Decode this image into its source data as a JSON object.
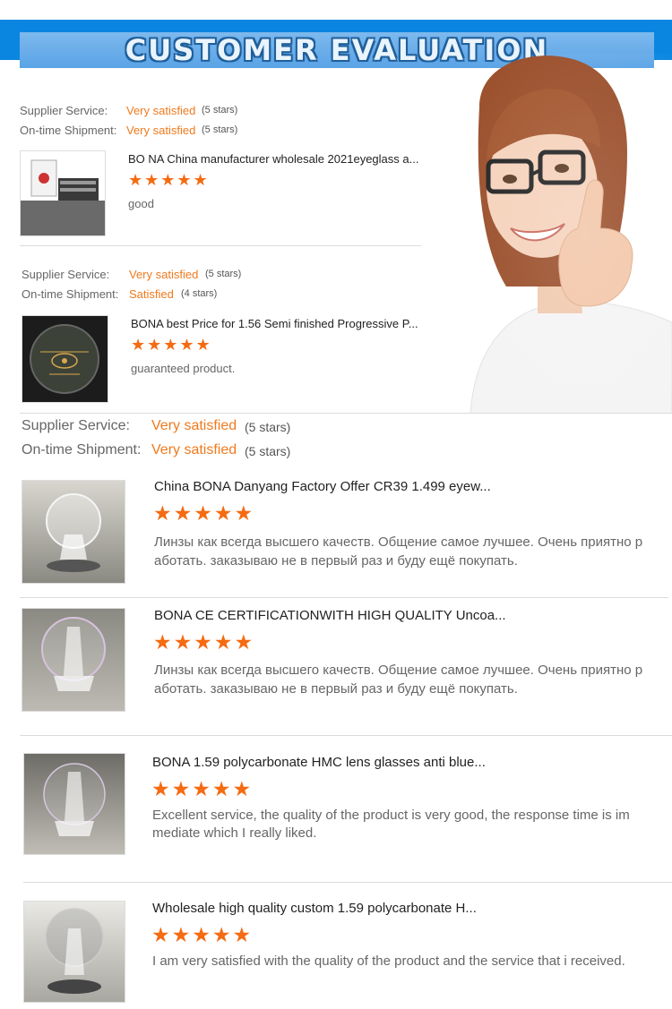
{
  "header": {
    "title": "CUSTOMER EVALUATION"
  },
  "reviews": [
    {
      "supplier_label": "Supplier Service:",
      "supplier_value": "Very satisfied",
      "supplier_stars": "(5 stars)",
      "shipment_label": "On-time Shipment:",
      "shipment_value": "Very satisfied",
      "shipment_stars": "(5 stars)",
      "title": "BO NA China manufacturer wholesale 2021eyeglass a...",
      "rating": "★★★★★",
      "comment": "good"
    },
    {
      "supplier_label": "Supplier Service:",
      "supplier_value": "Very satisfied",
      "supplier_stars": "(5 stars)",
      "shipment_label": "On-time Shipment:",
      "shipment_value": "Satisfied",
      "shipment_stars": "(4 stars)",
      "title": "BONA best Price for 1.56 Semi finished Progressive P...",
      "rating": "★★★★★",
      "comment": "guaranteed product."
    },
    {
      "supplier_label": "Supplier Service:",
      "supplier_value": "Very satisfied",
      "supplier_stars": "(5 stars)",
      "shipment_label": "On-time Shipment:",
      "shipment_value": "Very satisfied",
      "shipment_stars": "(5 stars)",
      "title": "China BONA Danyang Factory Offer CR39 1.499 eyew...",
      "rating": "★★★★★",
      "comment_line1": "Линзы как всегда высшего качеств. Общение самое лучшее. Очень приятно р",
      "comment_line2": "аботать. заказываю не в первый раз и буду ещё покупать."
    },
    {
      "title": "BONA CE CERTIFICATIONWITH HIGH QUALITY Uncoa...",
      "rating": "★★★★★",
      "comment_line1": "Линзы как всегда высшего качеств. Общение самое лучшее. Очень приятно р",
      "comment_line2": "аботать. заказываю не в первый раз и буду ещё покупать."
    },
    {
      "title": "BONA 1.59 polycarbonate HMC lens glasses anti blue...",
      "rating": "★★★★★",
      "comment_line1": "Excellent service, the quality of the product is very good, the response time is im",
      "comment_line2": "mediate which I really liked."
    },
    {
      "title": "Wholesale high quality custom 1.59 polycarbonate H...",
      "rating": "★★★★★",
      "comment_line1": "I am very satisfied with the quality of the product and the service that i received."
    }
  ]
}
